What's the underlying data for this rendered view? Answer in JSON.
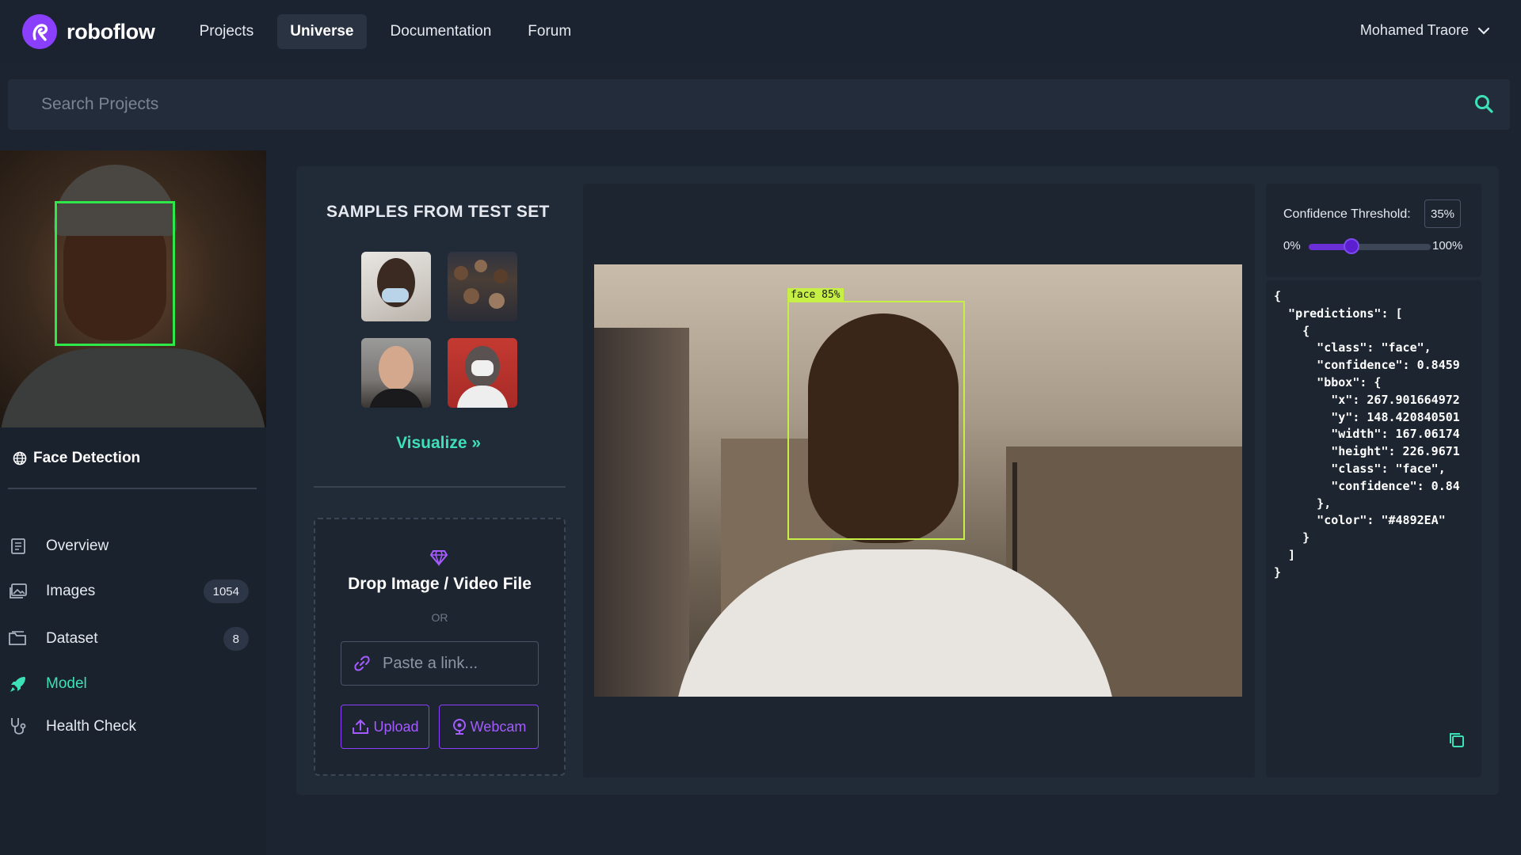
{
  "brand": {
    "name": "roboflow",
    "accent": "#8a3ffc"
  },
  "nav": {
    "links": [
      {
        "label": "Projects",
        "active": false
      },
      {
        "label": "Universe",
        "active": true
      },
      {
        "label": "Documentation",
        "active": false
      },
      {
        "label": "Forum",
        "active": false
      }
    ],
    "user": "Mohamed Traore"
  },
  "search": {
    "placeholder": "Search Projects",
    "icon": "search-icon"
  },
  "sidebar": {
    "project_title": "Face Detection",
    "items": [
      {
        "label": "Overview",
        "icon": "document-icon",
        "count": null,
        "active": false
      },
      {
        "label": "Images",
        "icon": "images-icon",
        "count": "1054",
        "active": false
      },
      {
        "label": "Dataset",
        "icon": "folder-icon",
        "count": "8",
        "active": false
      },
      {
        "label": "Model",
        "icon": "rocket-icon",
        "count": null,
        "active": true
      },
      {
        "label": "Health Check",
        "icon": "stethoscope-icon",
        "count": null,
        "active": false
      }
    ]
  },
  "samples": {
    "title": "SAMPLES FROM TEST SET",
    "visualize": "Visualize »"
  },
  "upload": {
    "title": "Drop Image / Video File",
    "or": "OR",
    "paste_placeholder": "Paste a link...",
    "upload_label": "Upload",
    "webcam_label": "Webcam"
  },
  "detection": {
    "label": "face 85%",
    "box_color": "#c6f046"
  },
  "confidence": {
    "label": "Confidence Threshold:",
    "value_text": "35%",
    "value": 35,
    "min_label": "0%",
    "max_label": "100%"
  },
  "json_output": "{\n  \"predictions\": [\n    {\n      \"class\": \"face\",\n      \"confidence\": 0.8459\n      \"bbox\": {\n        \"x\": 267.901664972\n        \"y\": 148.420840501\n        \"width\": 167.06174\n        \"height\": 226.9671\n        \"class\": \"face\",\n        \"confidence\": 0.84\n      },\n      \"color\": \"#4892EA\"\n    }\n  ]\n}"
}
